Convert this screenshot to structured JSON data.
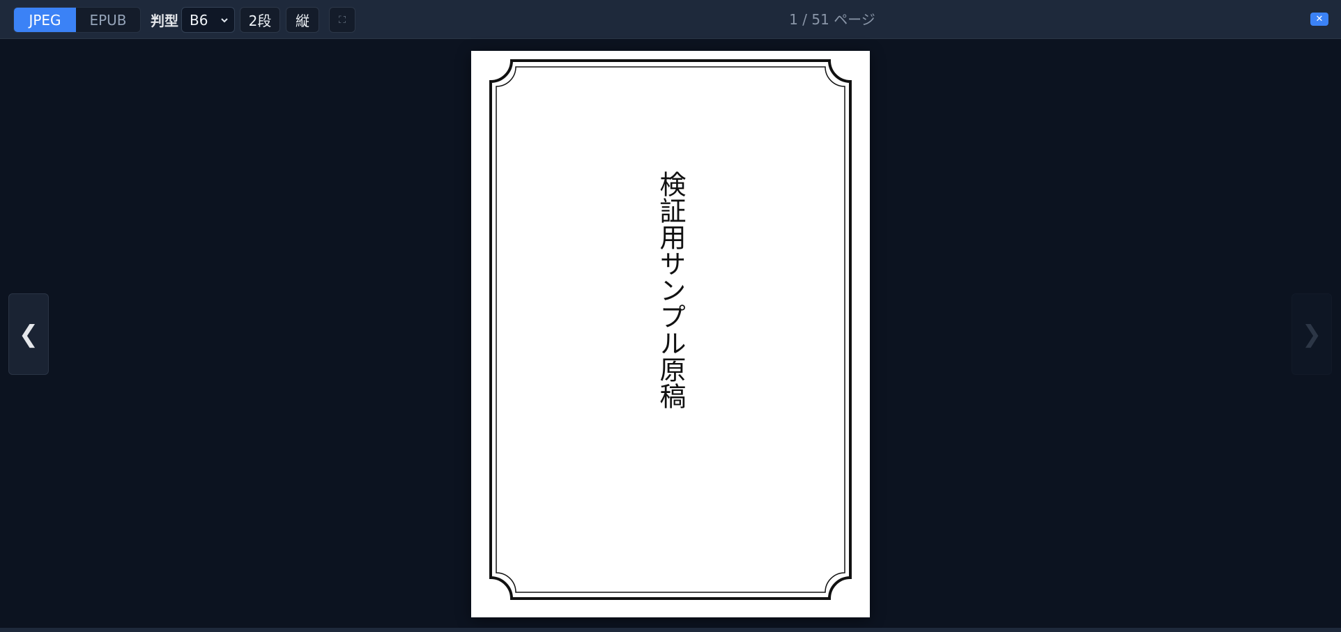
{
  "toolbar": {
    "formats": [
      "JPEG",
      "EPUB"
    ],
    "active_format": "JPEG",
    "size_label": "判型",
    "size_value": "B6",
    "columns_label": "2段",
    "orientation_label": "縦",
    "fullscreen_icon": "⛶",
    "page_counter": "1 / 51 ページ",
    "close_icon": "✕"
  },
  "nav": {
    "prev_icon": "❮",
    "next_icon": "❯"
  },
  "page": {
    "title": "検証用サンプル原稿"
  },
  "colors": {
    "accent": "#3b82f6",
    "background": "#0c1320",
    "toolbar": "#1e293b"
  }
}
